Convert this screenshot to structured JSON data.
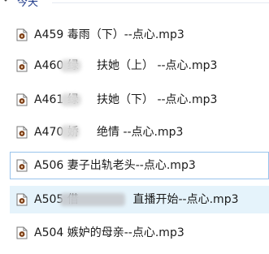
{
  "group": {
    "title": "今天"
  },
  "files": [
    {
      "name": "A459 毒雨（下）--点心.mp3"
    },
    {
      "name": "A460 绿     扶她（上） --点心.mp3"
    },
    {
      "name": "A461 绿     扶她（下） --点心.mp3"
    },
    {
      "name": "A470 娇     绝情 --点心.mp3"
    },
    {
      "name": "A506 妻子出轨老头--点心.mp3"
    },
    {
      "name": "A505 借               直播开始--点心.mp3"
    },
    {
      "name": "A504 嫉妒的母亲--点心.mp3"
    }
  ],
  "icons": {
    "group_toggle": "chevron-down-icon",
    "file_type": "audio-file-icon"
  },
  "colors": {
    "group_title": "#1e3a8a",
    "selection_border": "#99c4ec",
    "hover_background": "#e5f3fb"
  }
}
